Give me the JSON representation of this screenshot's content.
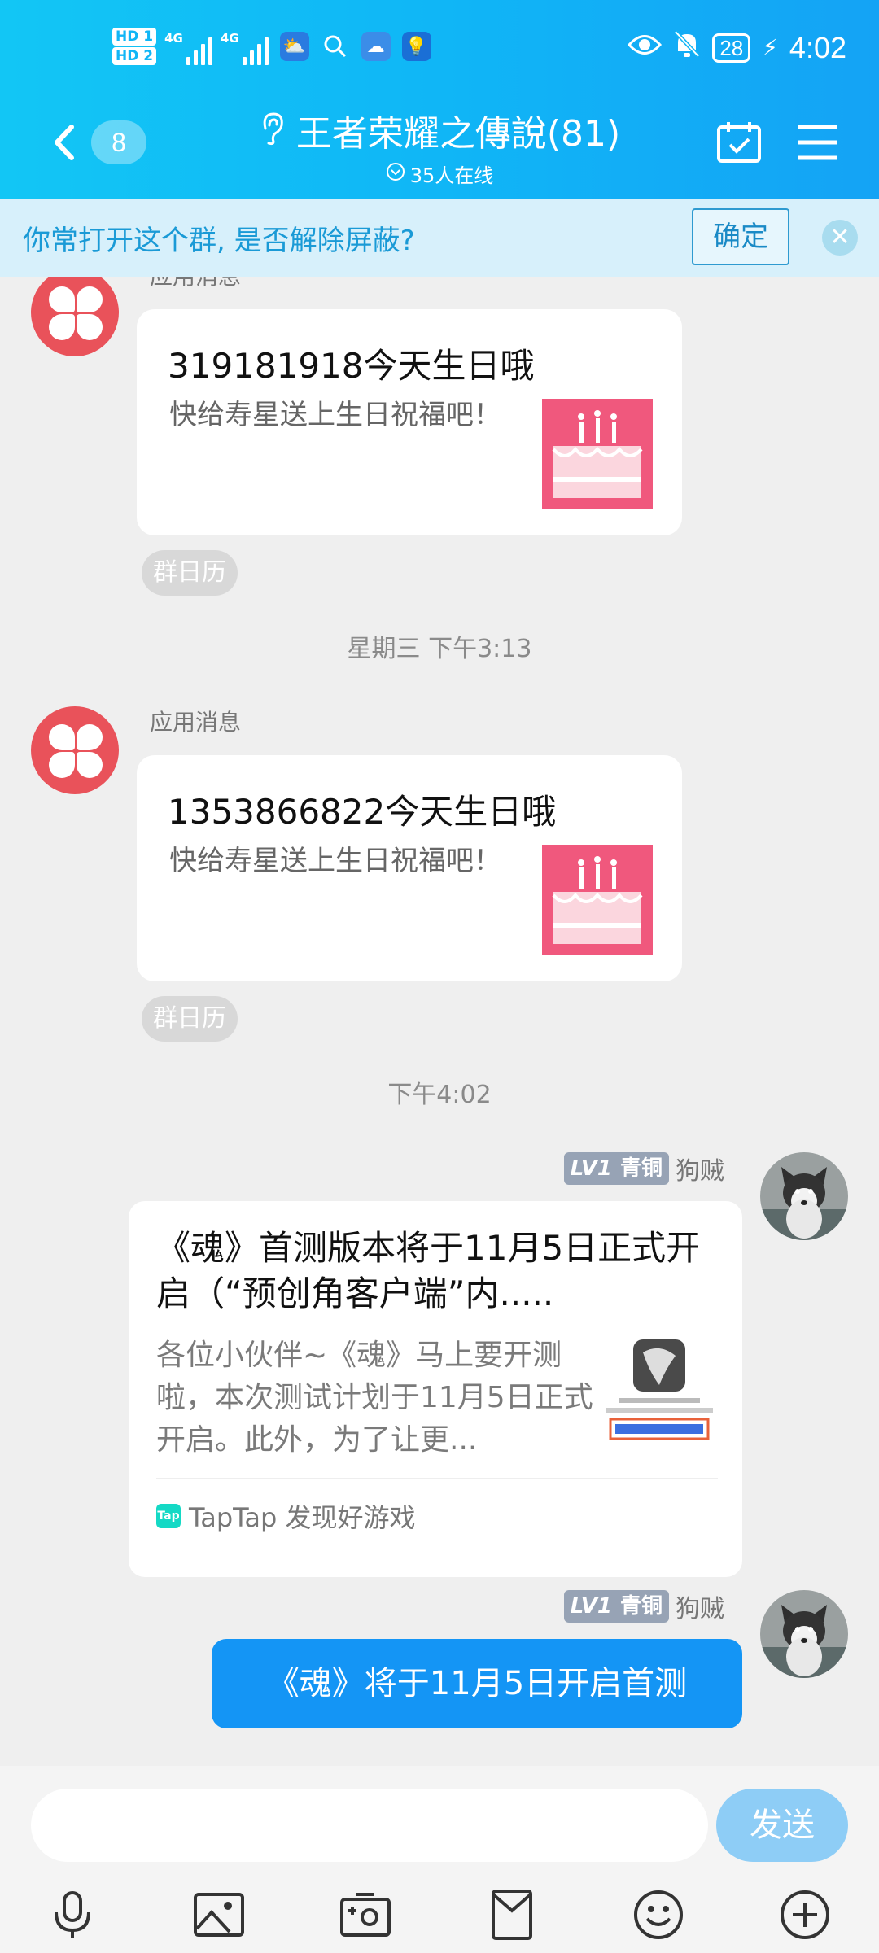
{
  "status_bar": {
    "hd_labels": [
      "HD 1",
      "HD 2"
    ],
    "network": [
      "4G",
      "4G"
    ],
    "battery": "28",
    "time": "4:02"
  },
  "header": {
    "unread_count": "8",
    "title": "王者荣耀之傳說(81)",
    "online": "35人在线"
  },
  "notice": {
    "text": "你常打开这个群, 是否解除屏蔽?",
    "confirm_label": "确定",
    "close_label": "✕"
  },
  "messages": [
    {
      "sender": "应用消息",
      "title": "319181918今天生日哦",
      "body": "快给寿星送上生日祝福吧！",
      "chip": "群日历"
    },
    {
      "timestamp": "星期三 下午3:13",
      "sender": "应用消息",
      "title": "1353866822今天生日哦",
      "body": "快给寿星送上生日祝福吧！",
      "chip": "群日历"
    }
  ],
  "timestamp2": "下午4:02",
  "self": {
    "level": "LV1",
    "rank": "青铜",
    "nick": "狗贼"
  },
  "share": {
    "title": "《魂》首测版本将于11月5日正式开启（“预创角客户端”内.....",
    "desc": "各位小伙伴~《魂》马上要开测啦，本次测试计划于11月5日正式开启。此外，为了让更...",
    "source_icon": "Tap",
    "source": "TapTap 发现好游戏"
  },
  "bubble_text": "《魂》将于11月5日开启首测",
  "input": {
    "placeholder": "",
    "send_label": "发送"
  },
  "colors": {
    "header": "#10b6f6",
    "notice_bg": "#d7f0fb",
    "bubble": "#1495f5",
    "app_avatar": "#e9525a",
    "cake": "#f0587d"
  }
}
